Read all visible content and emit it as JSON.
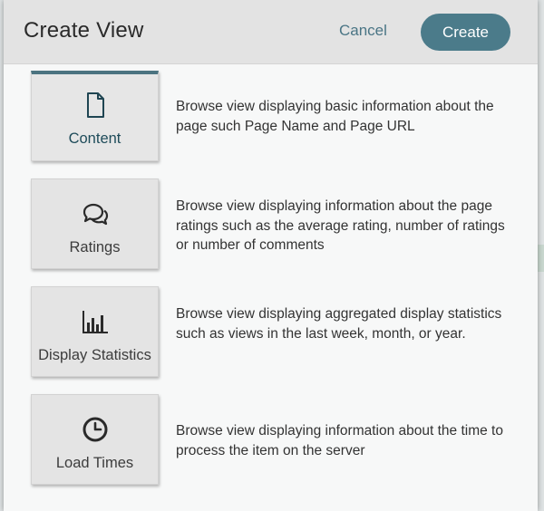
{
  "dialog": {
    "title": "Create View",
    "cancel_label": "Cancel",
    "create_label": "Create"
  },
  "options": [
    {
      "label": "Content",
      "icon": "document-icon",
      "selected": true,
      "description": "Browse view displaying basic information about the page such Page Name and Page URL"
    },
    {
      "label": "Ratings",
      "icon": "speech-bubbles-icon",
      "selected": false,
      "description": "Browse view displaying information about the page ratings such as the average rating, number of ratings or number of comments"
    },
    {
      "label": "Display Statistics",
      "icon": "bar-chart-icon",
      "selected": false,
      "description": "Browse view displaying aggregated display statistics such as views in the last week, month, or year."
    },
    {
      "label": "Load Times",
      "icon": "clock-icon",
      "selected": false,
      "description": "Browse view displaying information about the time to process the item on the server"
    }
  ],
  "colors": {
    "accent": "#4b7b8a",
    "selected_bar": "#4b7380",
    "header_bg": "#e3e3e3",
    "tile_bg": "#e4e4e4"
  }
}
